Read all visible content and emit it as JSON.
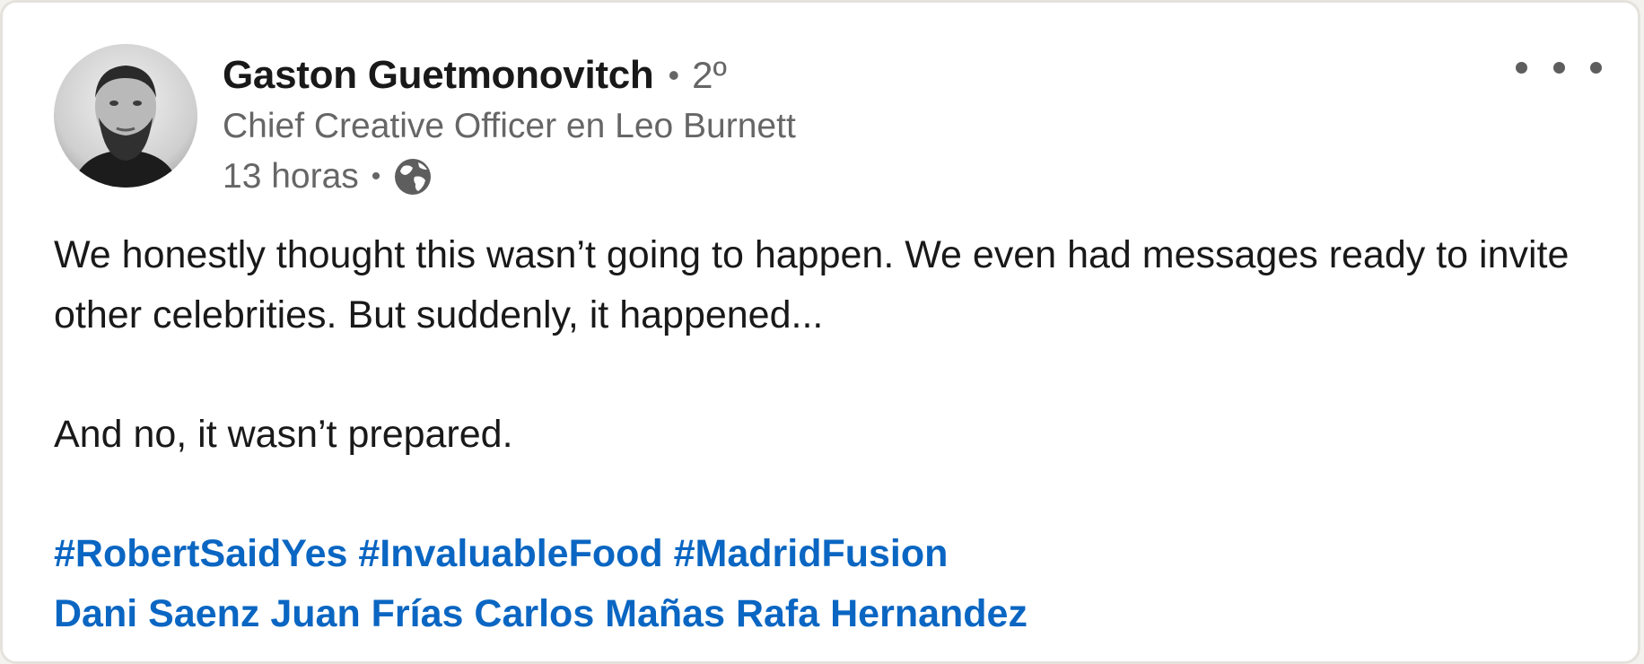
{
  "post": {
    "author": {
      "name": "Gaston Guetmonovitch",
      "separator": "•",
      "degree": "2º",
      "headline": "Chief Creative Officer en Leo Burnett",
      "time": "13 horas",
      "time_separator": "•",
      "visibility_icon": "globe-icon"
    },
    "menu_icon": "ellipsis-icon",
    "body": {
      "line1": "We honestly thought this wasn’t going to happen. We even had messages ready to invite other celebrities. But suddenly, it happened...",
      "line2": "And no, it wasn’t prepared."
    },
    "hashtags": [
      "#RobertSaidYes",
      "#InvaluableFood",
      "#MadridFusion"
    ],
    "mentions": [
      "Dani Saenz",
      "Juan Frías",
      "Carlos Mañas",
      "Rafa Hernandez"
    ],
    "colors": {
      "link": "#0a66c2",
      "text": "#191919",
      "secondary_text": "#666666"
    }
  }
}
